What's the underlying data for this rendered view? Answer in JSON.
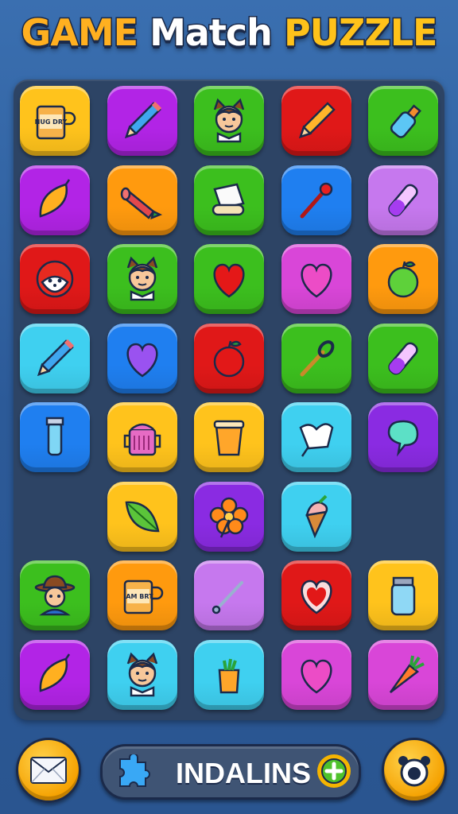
{
  "title": {
    "word1": "GAME",
    "word2": "Match",
    "word3": "PUZZLE"
  },
  "colors": {
    "yellow": "#ffc31c",
    "purple": "#b224e6",
    "green": "#3cbf1e",
    "red": "#e01818",
    "orange": "#ff9a0e",
    "cyan": "#3fd0f0",
    "blue": "#1f7ff0",
    "violet": "#8a2be2",
    "pink": "#d946d8",
    "lilac": "#c678ee",
    "deepblue": "#1565d8"
  },
  "grid": [
    [
      "mug-dry-icon",
      "pencil-blue-icon",
      "boy-cat-ears-icon",
      "pencil-orange-icon",
      "bottle-blue-icon"
    ],
    [
      "leaf-orange-icon",
      "wood-log-icon",
      "paper-scroll-icon",
      "match-stick-icon",
      "test-tube-icon"
    ],
    [
      "red-panda-icon",
      "boy-cat-ears-icon",
      "heart-red-icon",
      "heart-pink-icon",
      "apple-green-icon"
    ],
    [
      "pencil-blue-icon",
      "heart-purple-icon",
      "apple-red-icon",
      "wrench-spoon-icon",
      "test-tube-icon"
    ],
    [
      "vial-icon",
      "pink-jar-icon",
      "cup-orange-icon",
      "cloth-icon",
      "speech-bubble-icon"
    ],
    [
      "empty",
      "leaf-green-icon",
      "flower-orange-icon",
      "ice-cream-icon",
      "empty"
    ],
    [
      "cowboy-icon",
      "mug-dry-icon",
      "stick-icon",
      "heart-outline-icon",
      "jar-blue-icon"
    ],
    [
      "leaf-orange-icon",
      "boy-cat-ears-icon",
      "carrot-cup-icon",
      "heart-pink-icon",
      "carrot-icon"
    ]
  ],
  "tile_colors": [
    [
      "yellow",
      "purple",
      "green",
      "red",
      "green"
    ],
    [
      "purple",
      "orange",
      "green",
      "blue",
      "lilac"
    ],
    [
      "red",
      "green",
      "green",
      "pink",
      "orange"
    ],
    [
      "cyan",
      "blue",
      "red",
      "green",
      "green"
    ],
    [
      "blue",
      "yellow",
      "yellow",
      "cyan",
      "violet"
    ],
    [
      "",
      "yellow",
      "violet",
      "cyan",
      ""
    ],
    [
      "green",
      "orange",
      "lilac",
      "red",
      "yellow"
    ],
    [
      "purple",
      "cyan",
      "cyan",
      "pink",
      "pink"
    ]
  ],
  "mug_text": [
    "NUG DRY",
    "IAM BRT"
  ],
  "bottom": {
    "currency_label": "INDALINS"
  }
}
